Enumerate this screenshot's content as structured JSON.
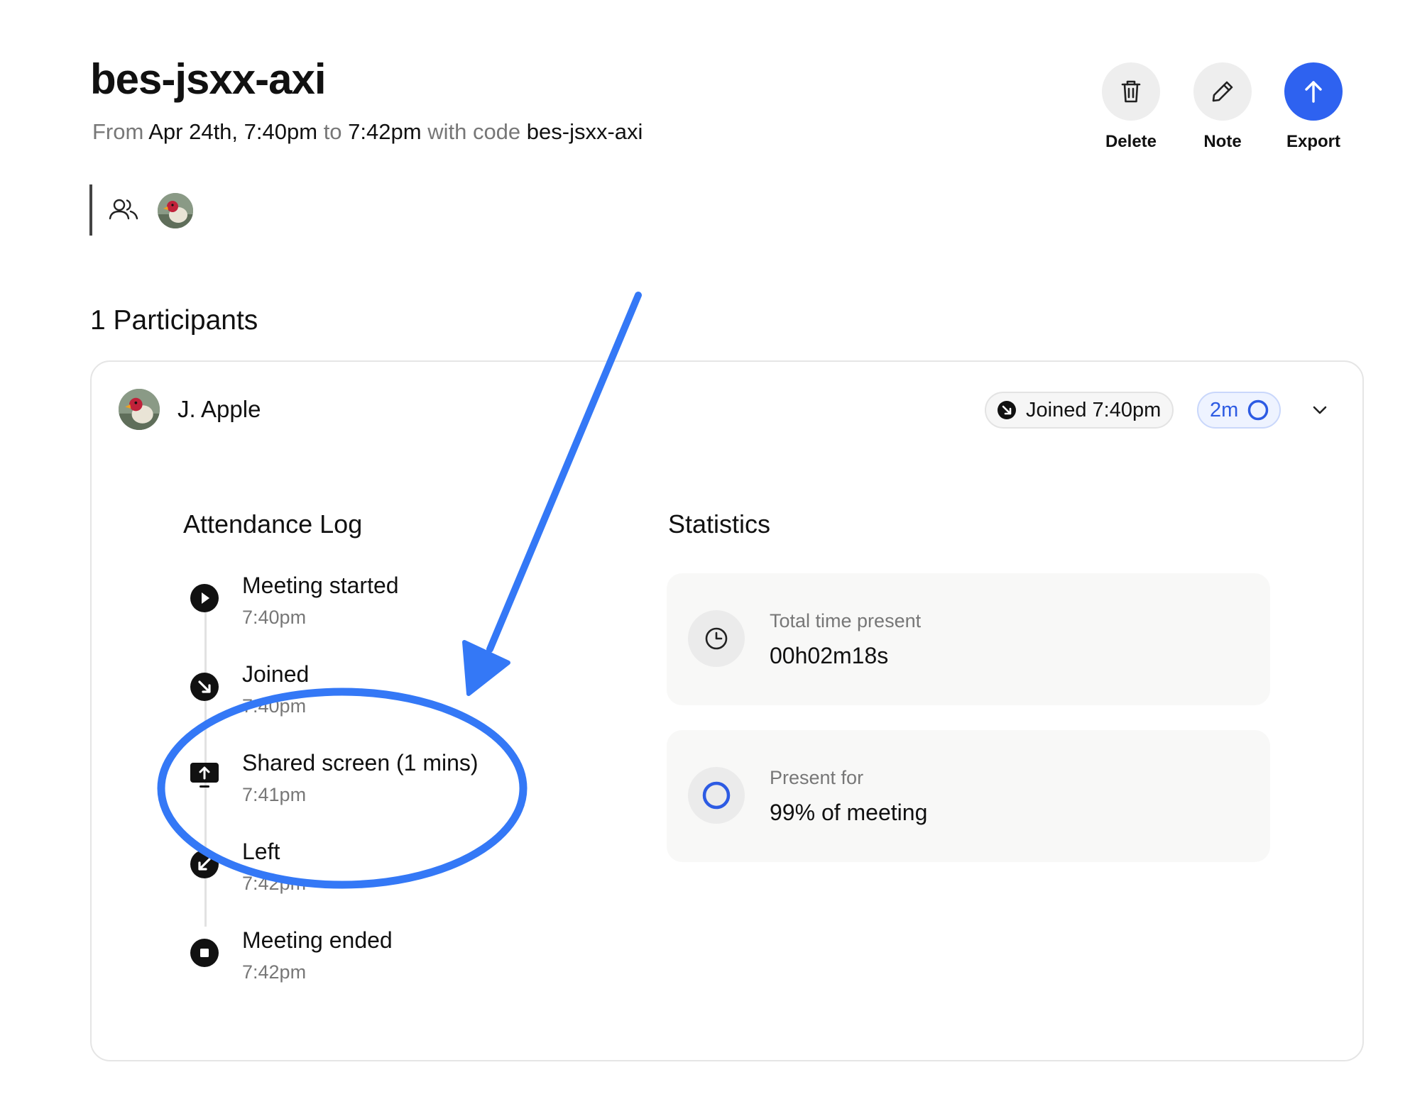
{
  "header": {
    "title": "bes-jsxx-axi",
    "subtitle": {
      "from_word": "From",
      "start": "Apr 24th, 7:40pm",
      "to_word": "to",
      "end": "7:42pm",
      "code_prefix": "with code",
      "code": "bes-jsxx-axi"
    }
  },
  "actions": {
    "delete_label": "Delete",
    "note_label": "Note",
    "export_label": "Export"
  },
  "participants_section": {
    "title": "1 Participants"
  },
  "participant": {
    "name": "J. Apple",
    "joined_badge": "Joined 7:40pm",
    "duration_badge": "2m"
  },
  "attendance_log": {
    "title": "Attendance Log",
    "events": [
      {
        "label": "Meeting started",
        "time": "7:40pm",
        "icon": "play-icon"
      },
      {
        "label": "Joined",
        "time": "7:40pm",
        "icon": "joined-arrow-icon"
      },
      {
        "label": "Shared screen (1 mins)",
        "time": "7:41pm",
        "icon": "screen-share-icon"
      },
      {
        "label": "Left",
        "time": "7:42pm",
        "icon": "left-arrow-icon"
      },
      {
        "label": "Meeting ended",
        "time": "7:42pm",
        "icon": "stop-icon"
      }
    ]
  },
  "statistics": {
    "title": "Statistics",
    "total_time": {
      "label": "Total time present",
      "value": "00h02m18s"
    },
    "present_for": {
      "label": "Present for",
      "value": "99% of meeting"
    }
  },
  "colors": {
    "accent": "#2e62f0",
    "annotation": "#3478f6"
  }
}
